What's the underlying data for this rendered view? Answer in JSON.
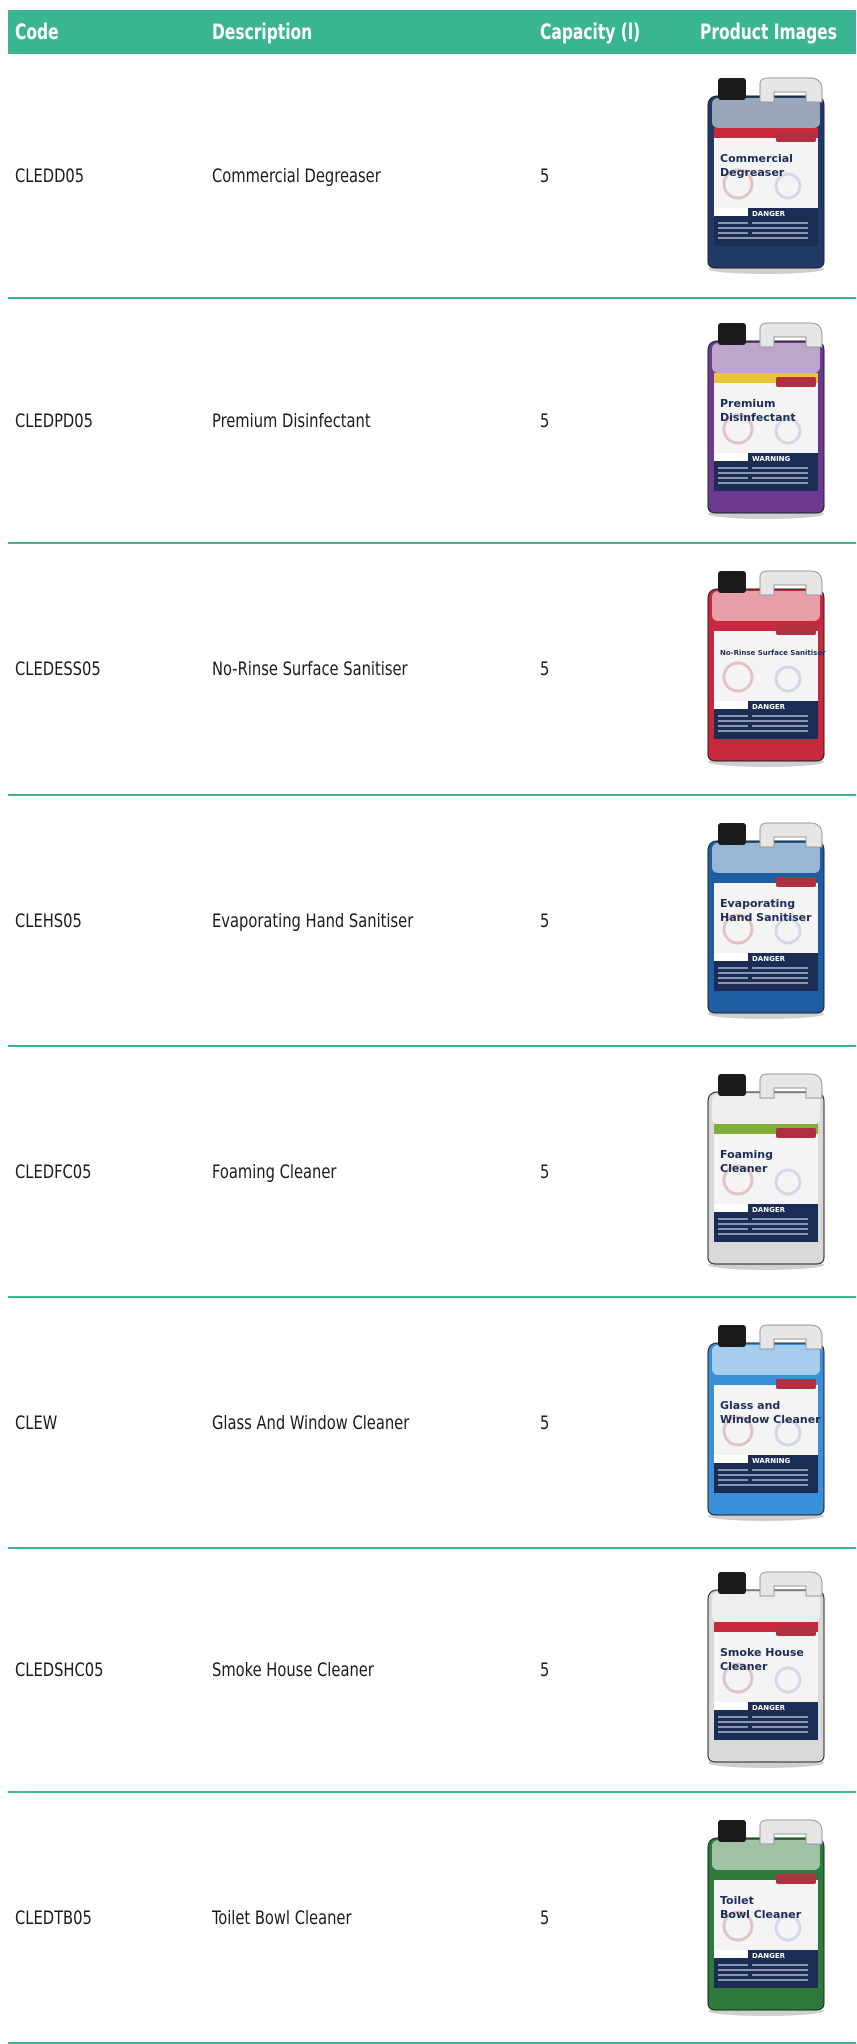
{
  "header": {
    "code": "Code",
    "description": "Description",
    "capacity": "Capacity (l)",
    "images": "Product Images"
  },
  "rows": [
    {
      "code": "CLEDD05",
      "description": "Commercial Degreaser",
      "capacity": "5",
      "label_lines": [
        "Commercial",
        "Degreaser"
      ],
      "liquid": "#1f3a66",
      "band": "#c8283c",
      "signal": "DANGER"
    },
    {
      "code": "CLEDPD05",
      "description": "Premium Disinfectant",
      "capacity": "5",
      "label_lines": [
        "Premium",
        "Disinfectant"
      ],
      "liquid": "#6b3a8f",
      "band": "#e8c43a",
      "signal": "WARNING"
    },
    {
      "code": "CLEDESS05",
      "description": "No-Rinse Surface Sanitiser",
      "capacity": "5",
      "label_lines": [
        "No-Rinse Surface Sanitiser"
      ],
      "liquid": "#c8283c",
      "band": "#c8283c",
      "signal": "DANGER"
    },
    {
      "code": "CLEHS05",
      "description": "Evaporating Hand Sanitiser",
      "capacity": "5",
      "label_lines": [
        "Evaporating",
        "Hand Sanitiser"
      ],
      "liquid": "#1f5da3",
      "band": "#1f5da3",
      "signal": "DANGER"
    },
    {
      "code": "CLEDFC05",
      "description": "Foaming Cleaner",
      "capacity": "5",
      "label_lines": [
        "Foaming",
        "Cleaner"
      ],
      "liquid": "#d9d9d9",
      "band": "#7fae3a",
      "signal": "DANGER"
    },
    {
      "code": "CLEW",
      "description": "Glass And Window Cleaner",
      "capacity": "5",
      "label_lines": [
        "Glass and",
        "Window Cleaner"
      ],
      "liquid": "#3a8fd9",
      "band": "#3a8fd9",
      "signal": "WARNING"
    },
    {
      "code": "CLEDSHC05",
      "description": "Smoke House Cleaner",
      "capacity": "5",
      "label_lines": [
        "Smoke House",
        "Cleaner"
      ],
      "liquid": "#d9d9d9",
      "band": "#c8283c",
      "signal": "DANGER"
    },
    {
      "code": "CLEDTB05",
      "description": "Toilet Bowl Cleaner",
      "capacity": "5",
      "label_lines": [
        "Toilet",
        "Bowl Cleaner"
      ],
      "liquid": "#2e7a3a",
      "band": "#2e7a3a",
      "signal": "DANGER"
    }
  ]
}
